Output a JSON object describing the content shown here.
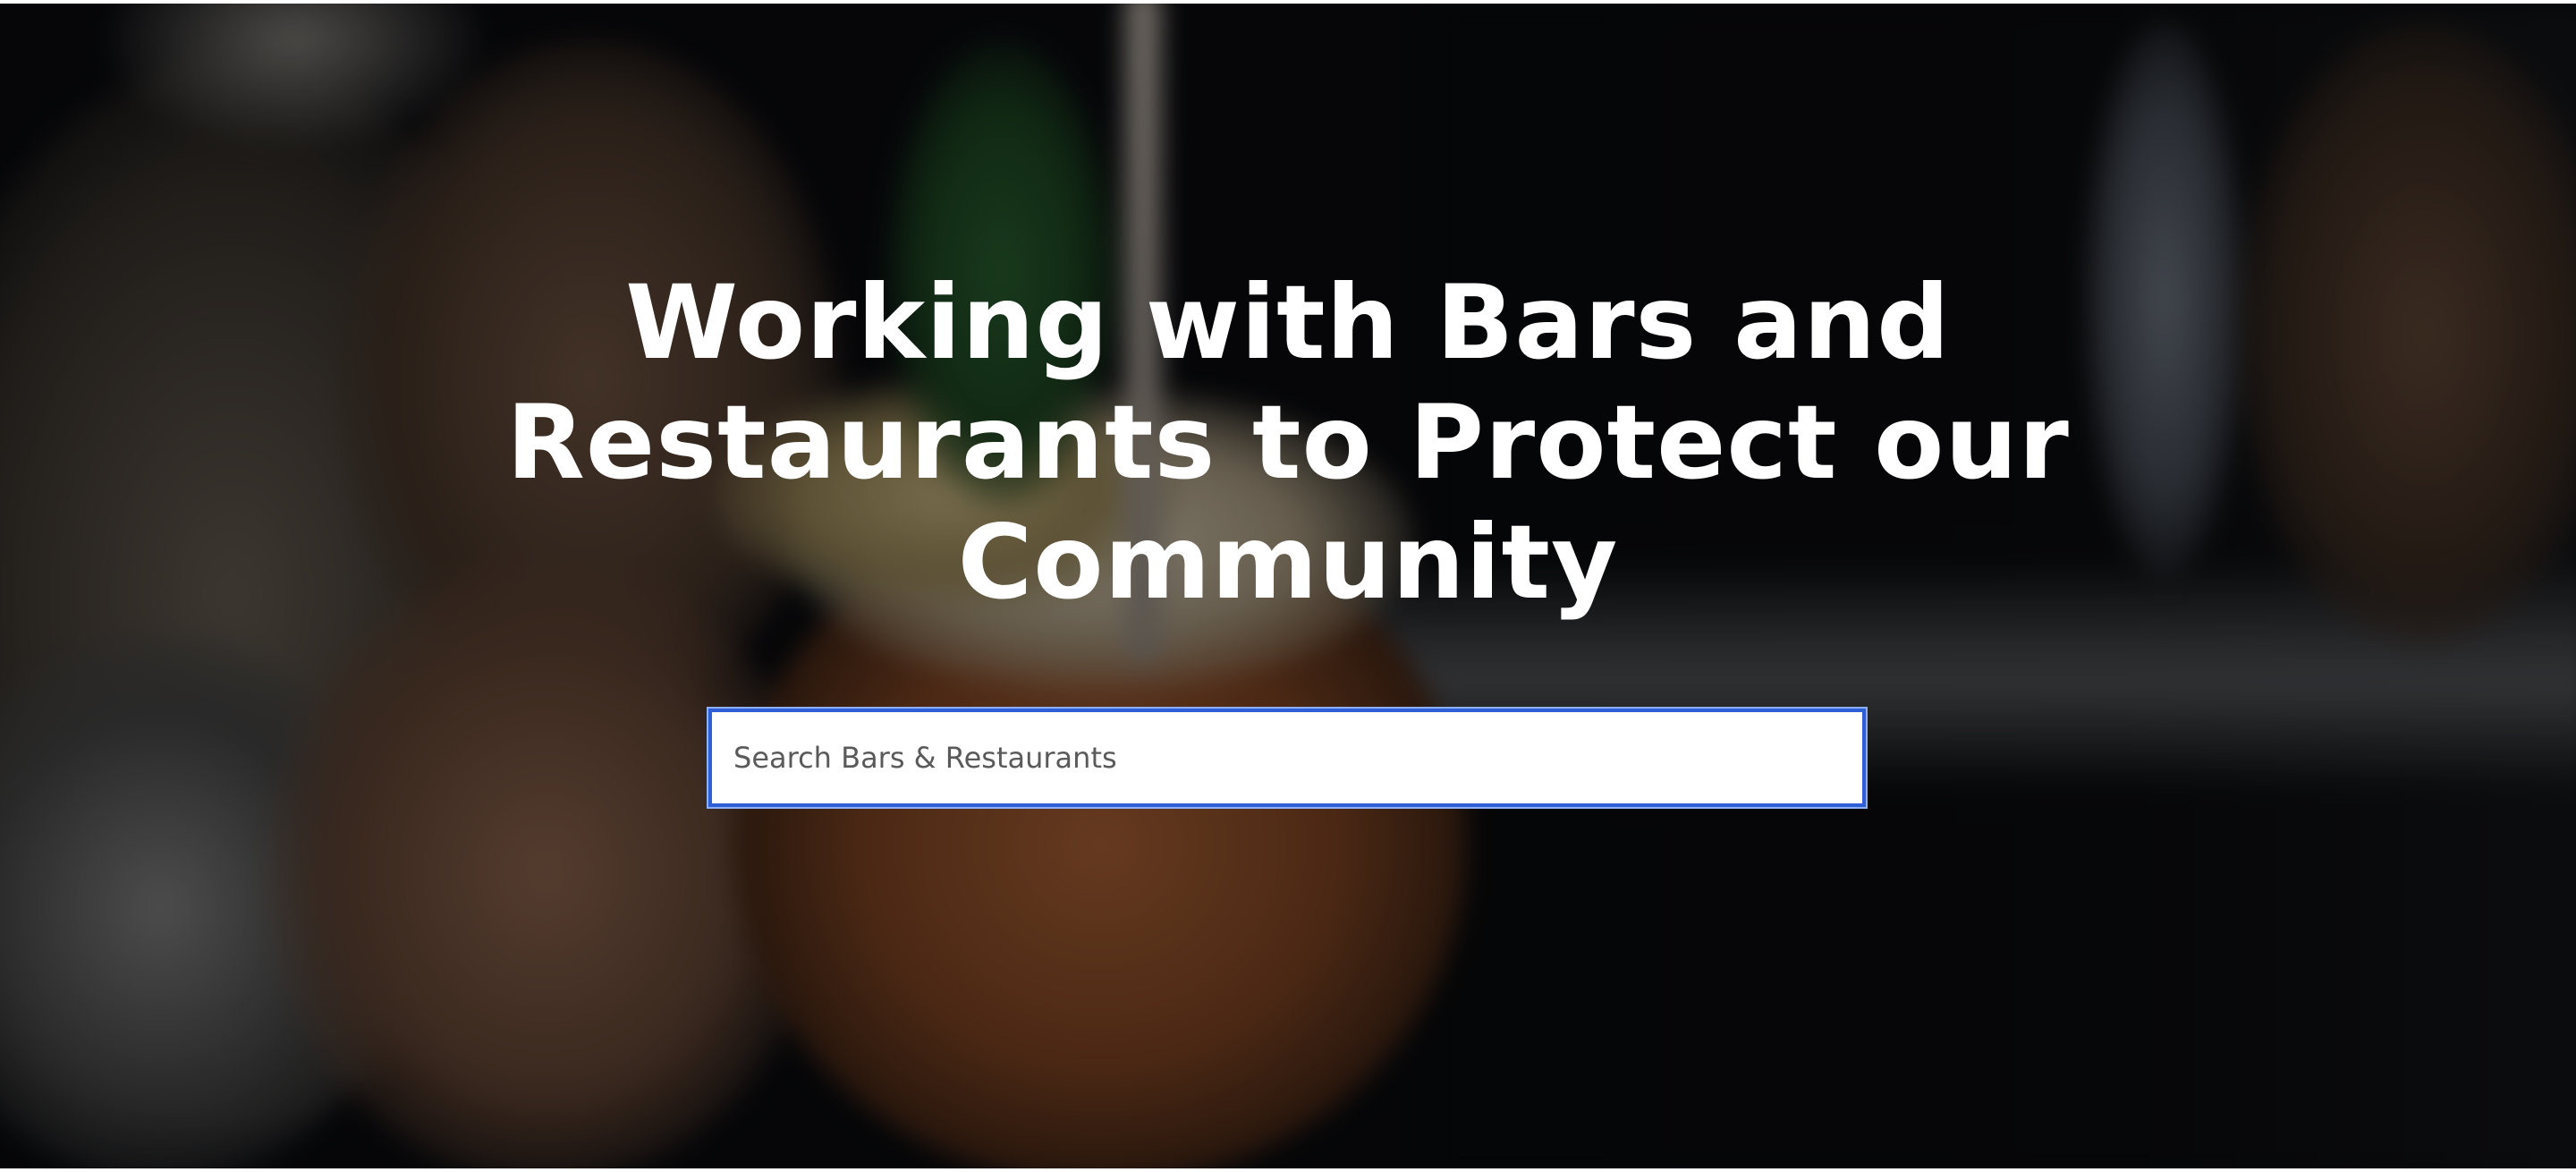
{
  "hero": {
    "title": "Working with Bars and Restaurants to Protect our Community",
    "background_image": "blurred-cocktail-photo"
  },
  "search": {
    "placeholder": "Search Bars & Restaurants",
    "value": "",
    "focused": true,
    "focus_color": "#2f5fd6"
  },
  "colors": {
    "title_text": "#ffffff",
    "overlay": "rgba(0,0,0,0.45)"
  }
}
